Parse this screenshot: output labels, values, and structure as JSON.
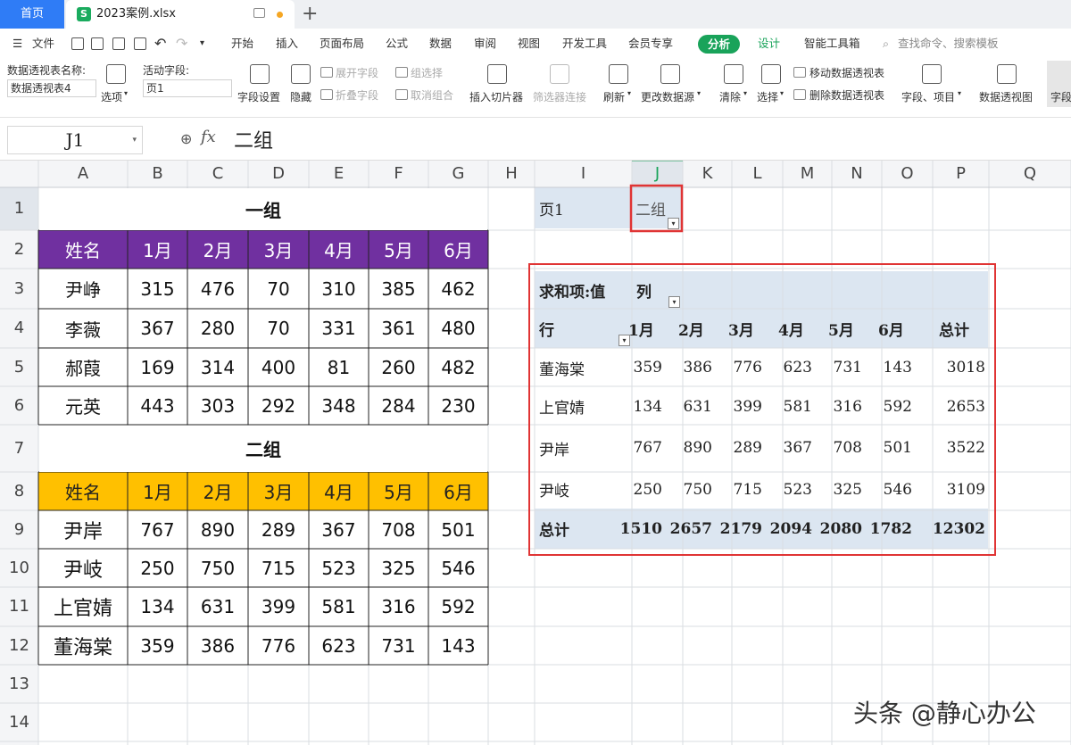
{
  "tabs": {
    "home": "首页",
    "file": "2023案例.xlsx"
  },
  "menu": {
    "file": "文件",
    "items": [
      "开始",
      "插入",
      "页面布局",
      "公式",
      "数据",
      "审阅",
      "视图",
      "开发工具",
      "会员专享"
    ],
    "analyze": "分析",
    "design": "设计",
    "smart": "智能工具箱",
    "search": "查找命令、搜索模板"
  },
  "ribbon": {
    "pivot_name_label": "数据透视表名称:",
    "pivot_name_value": "数据透视表4",
    "options": "选项",
    "active_field_label": "活动字段:",
    "active_field_value": "页1",
    "field_settings": "字段设置",
    "hide": "隐藏",
    "expand_field": "展开字段",
    "collapse_field": "折叠字段",
    "group_select": "组选择",
    "ungroup": "取消组合",
    "insert_slicer": "插入切片器",
    "filter_connect": "筛选器连接",
    "refresh": "刷新",
    "change_source": "更改数据源",
    "clear": "清除",
    "select": "选择",
    "move_pivot": "移动数据透视表",
    "delete_pivot": "删除数据透视表",
    "fields_items": "字段、项目",
    "pivot_chart": "数据透视图",
    "field_list": "字段"
  },
  "formula_bar": {
    "name_box": "J1",
    "fx": "fx",
    "value": "二组"
  },
  "columns": [
    "A",
    "B",
    "C",
    "D",
    "E",
    "F",
    "G",
    "H",
    "I",
    "J",
    "K",
    "L",
    "M",
    "N",
    "O",
    "P",
    "Q"
  ],
  "rows": [
    "1",
    "2",
    "3",
    "4",
    "5",
    "6",
    "7",
    "8",
    "9",
    "10",
    "11",
    "12",
    "13",
    "14"
  ],
  "colors": {
    "group1_header": "#7030a0",
    "group2_header": "#ffc000",
    "pivot_fill": "#dce6f1",
    "highlight_border": "#e03434",
    "analyze_green": "#19a35a"
  },
  "group1": {
    "title": "一组",
    "headers": [
      "姓名",
      "1月",
      "2月",
      "3月",
      "4月",
      "5月",
      "6月"
    ],
    "rows": [
      [
        "尹峥",
        "315",
        "476",
        "70",
        "310",
        "385",
        "462"
      ],
      [
        "李薇",
        "367",
        "280",
        "70",
        "331",
        "361",
        "480"
      ],
      [
        "郝葭",
        "169",
        "314",
        "400",
        "81",
        "260",
        "482"
      ],
      [
        "元英",
        "443",
        "303",
        "292",
        "348",
        "284",
        "230"
      ]
    ]
  },
  "group2": {
    "title": "二组",
    "headers": [
      "姓名",
      "1月",
      "2月",
      "3月",
      "4月",
      "5月",
      "6月"
    ],
    "rows": [
      [
        "尹岸",
        "767",
        "890",
        "289",
        "367",
        "708",
        "501"
      ],
      [
        "尹岐",
        "250",
        "750",
        "715",
        "523",
        "325",
        "546"
      ],
      [
        "上官婧",
        "134",
        "631",
        "399",
        "581",
        "316",
        "592"
      ],
      [
        "董海棠",
        "359",
        "386",
        "776",
        "623",
        "731",
        "143"
      ]
    ]
  },
  "pivot": {
    "page_label": "页1",
    "page_value": "二组",
    "sum_label": "求和项:值",
    "col_label": "列",
    "row_label": "行",
    "columns": [
      "1月",
      "2月",
      "3月",
      "4月",
      "5月",
      "6月",
      "总计"
    ],
    "rows": [
      {
        "name": "董海棠",
        "values": [
          "359",
          "386",
          "776",
          "623",
          "731",
          "143",
          "3018"
        ]
      },
      {
        "name": "上官婧",
        "values": [
          "134",
          "631",
          "399",
          "581",
          "316",
          "592",
          "2653"
        ]
      },
      {
        "name": "尹岸",
        "values": [
          "767",
          "890",
          "289",
          "367",
          "708",
          "501",
          "3522"
        ]
      },
      {
        "name": "尹岐",
        "values": [
          "250",
          "750",
          "715",
          "523",
          "325",
          "546",
          "3109"
        ]
      }
    ],
    "total_label": "总计",
    "totals": [
      "1510",
      "2657",
      "2179",
      "2094",
      "2080",
      "1782",
      "12302"
    ]
  },
  "watermark": "头条 @静心办公"
}
